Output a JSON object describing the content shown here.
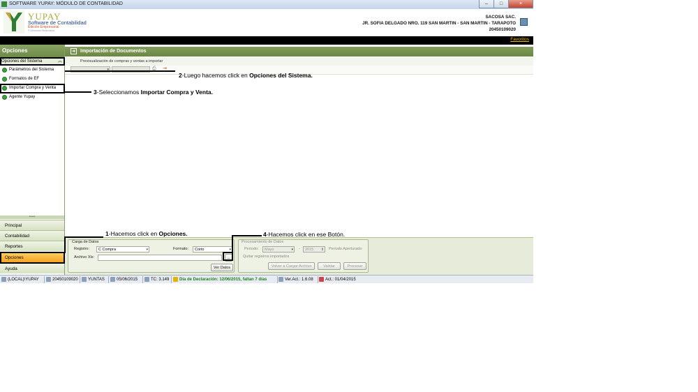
{
  "window": {
    "title": "SOFTWARE YUPAY: MÓDULO DE CONTABILIDAD",
    "min": "–",
    "max": "□",
    "close": "×"
  },
  "header": {
    "brand": "YUPAY",
    "subtitle": "Software de Contabilidad",
    "edition": "Edición Empresarial",
    "rights": "© Derechos Reservados",
    "company_name": "SACOSA SAC.",
    "company_address": "JR. SOFIA DELGADO NRO. 119 SAN MARTIN - SAN MARTIN - TARAPOTO",
    "company_ruc": "20450109020",
    "favorites": "Favoritos"
  },
  "sidebar": {
    "title": "Opciones",
    "section": "Opciones del Sistema",
    "items": [
      {
        "label": "Parámetros del Sistema"
      },
      {
        "label": "Formatos de EF"
      },
      {
        "label": "Importar Compra y Venta"
      },
      {
        "label": "Agente Yupay"
      }
    ],
    "nav": [
      {
        "label": "Principal"
      },
      {
        "label": "Contabilidad"
      },
      {
        "label": "Reportes"
      },
      {
        "label": "Opciones"
      },
      {
        "label": "Ayuda"
      }
    ]
  },
  "main": {
    "title": "Importación de Documentos",
    "subtitle": "Previsualización de compras y ventas a importar"
  },
  "carga": {
    "title": "Carga de Datos",
    "registro_label": "Registro:",
    "registro_value": "C   Compra",
    "formato_label": "Formato:",
    "formato_value": "Corto",
    "archivo_label": "Archivo Xls:",
    "browse_label": "...",
    "ver_datos": "Ver Datos"
  },
  "procesamiento": {
    "title": "Procesamiento de Datos",
    "periodo_label": "Periodo:",
    "mes": "Mayo",
    "anio": "2015",
    "aperturado": "Periodo Aperturado",
    "quitar": "Quitar registros importados",
    "volver": "Volver a Cargar Archivo",
    "validar": "Validar",
    "procesar": "Procesar"
  },
  "status": {
    "server": "(LOCAL)\\YUPAY",
    "ruc": "20450109020",
    "user": "YUNTAS",
    "date": "05/06/2015",
    "tc": "TC: 3.149",
    "declaracion": "Día de Declaración: 12/06/2015, faltan 7 días",
    "version": "Ver.Act.: 1.6.08",
    "act": "Act.: 01/04/2015"
  },
  "annotations": {
    "a1_num": "1",
    "a1_text": "-Hacemos click en ",
    "a1_bold": "Opciones.",
    "a2_num": "2",
    "a2_text": "-Luego hacemos click en ",
    "a2_bold": "Opciones del Sistema.",
    "a3_num": "3",
    "a3_text": "-Seleccionamos ",
    "a3_bold": "Importar Compra y Venta.",
    "a4_num": "4",
    "a4_text": "-Hacemos click en ese Botón."
  },
  "colors": {
    "accent": "#6a8743",
    "active_nav": "#f4a321",
    "declaration": "#1a7f1a"
  }
}
